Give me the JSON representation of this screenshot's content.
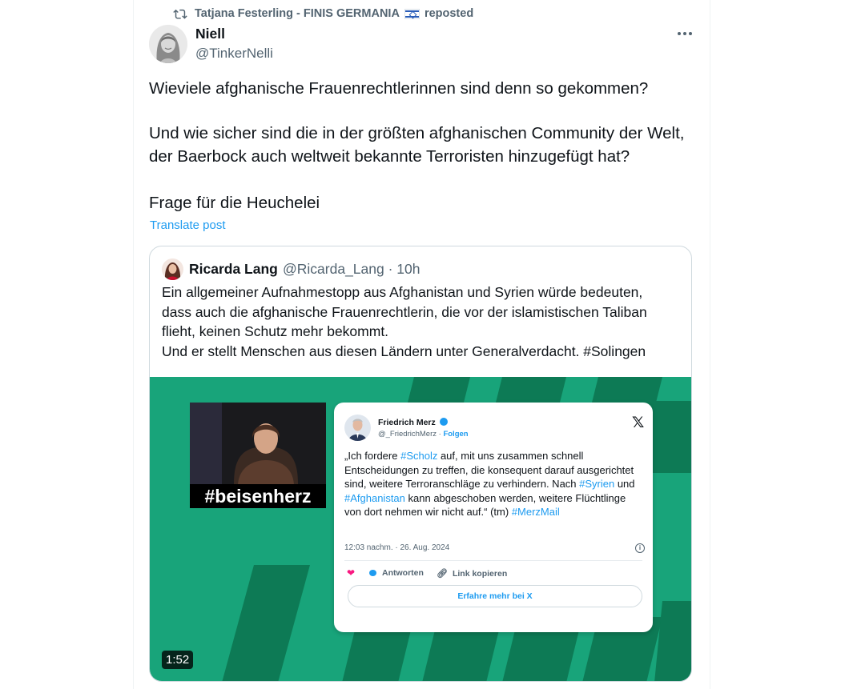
{
  "repost": {
    "icon": "repost-icon",
    "name": "Tatjana Festerling - FINIS GERMANIA",
    "flag": "israel-flag-icon",
    "suffix": "reposted"
  },
  "post": {
    "author_name": "Niell",
    "author_handle": "@TinkerNelli",
    "paragraphs": [
      "Wieviele afghanische Frauenrechtlerinnen sind denn so gekommen?",
      "Und wie sicher sind die in der größten afghanischen Community der Welt, der Baerbock auch weltweit bekannte Terroristen hinzugefügt hat?",
      "Frage für die Heuchelei"
    ],
    "translate": "Translate post",
    "more_icon": "more-options-icon"
  },
  "quote": {
    "name": "Ricarda Lang",
    "handle": "@Ricarda_Lang",
    "time": "· 10h",
    "text_lines": [
      "Ein allgemeiner Aufnahmestopp aus Afghanistan und Syrien würde bedeuten,",
      "dass auch die afghanische Frauenrechtlerin, die vor der islamistischen Taliban",
      "flieht, keinen Schutz mehr bekommt.",
      "Und er stellt Menschen aus diesen Ländern unter Generalverdacht. #Solingen"
    ]
  },
  "video": {
    "hashtag": "#beisenherz",
    "duration": "1:52",
    "colors": {
      "bg": "#18a47a",
      "stripe": "#0d7a55"
    },
    "embedded": {
      "name": "Friedrich Merz",
      "handle": "@_FriedrichMerz",
      "follow": "Folgen",
      "x_logo": "𝕏",
      "text": {
        "t1": "„Ich fordere ",
        "h1": "#Scholz",
        "t2": " auf, mit uns zusammen schnell Entscheidungen zu treffen, die konsequent darauf ausgerichtet sind, weitere Terroranschläge zu verhindern. Nach ",
        "h2": "#Syrien",
        "t3": " und ",
        "h3": "#Afghanistan",
        "t4": " kann abgeschoben werden, weitere Flüchtlinge von dort nehmen wir nicht auf.“ (tm) ",
        "h4": "#MerzMail"
      },
      "date": "12:03 nachm. · 26. Aug. 2024",
      "reply": "Antworten",
      "copy": "Link kopieren",
      "more_button": "Erfahre mehr bei X"
    }
  }
}
